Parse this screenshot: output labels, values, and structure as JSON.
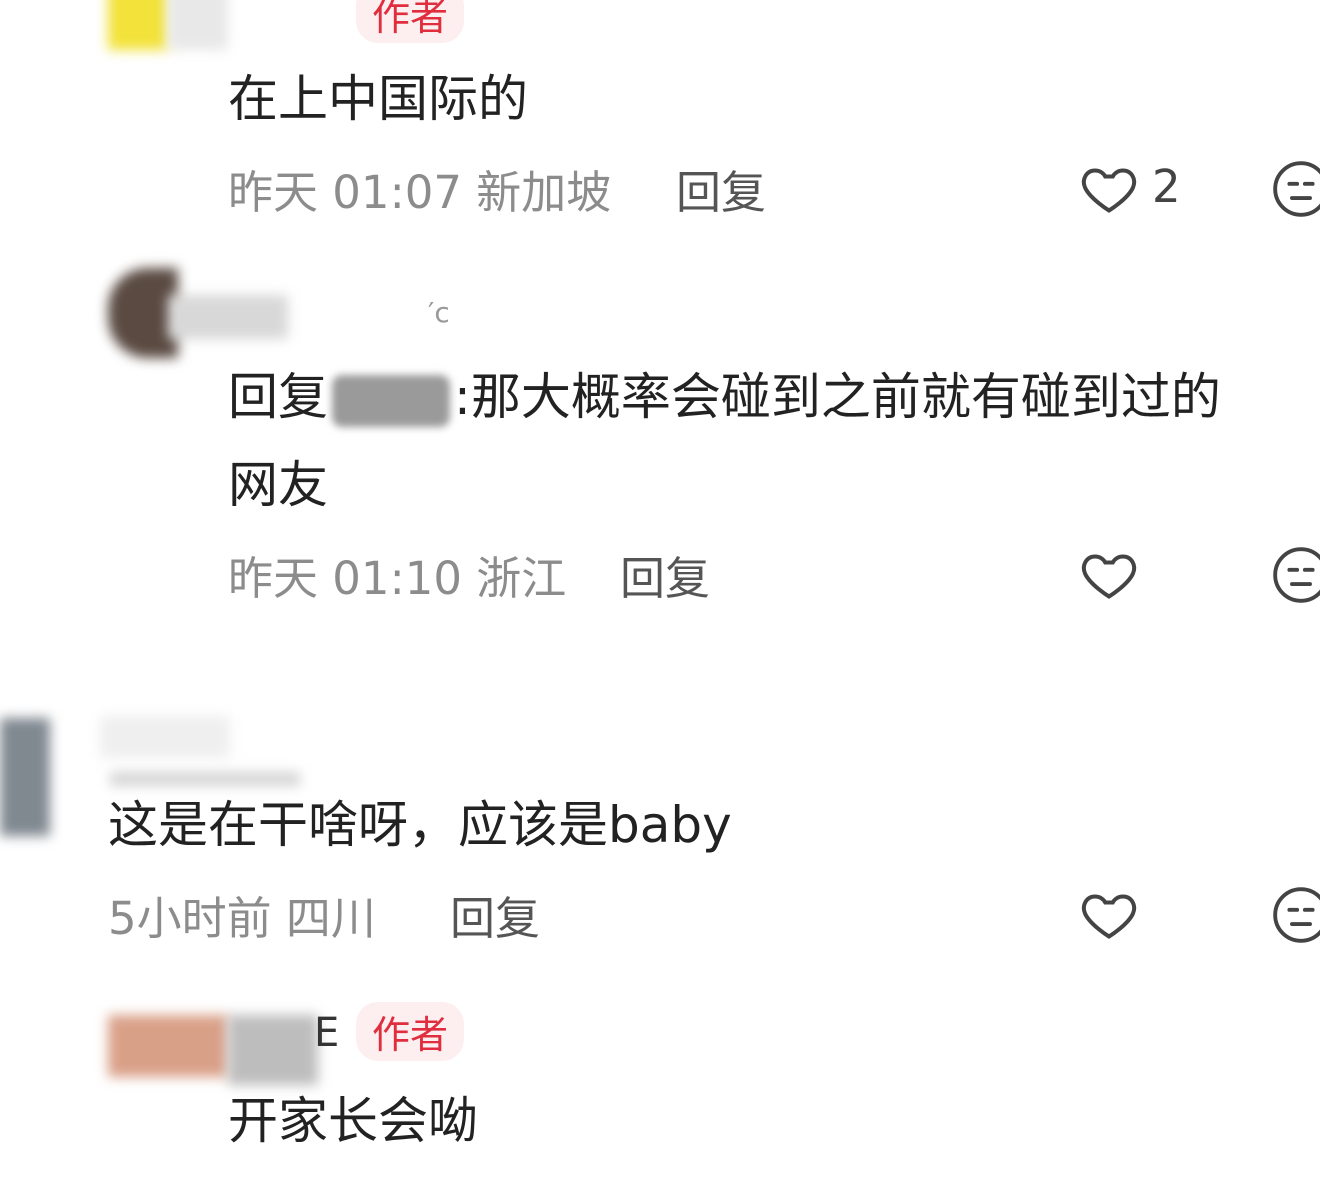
{
  "comments": [
    {
      "author_tag": "作者",
      "body": "在上中国际的",
      "meta": "昨天 01:07 新加坡",
      "reply_label": "回复",
      "like_count": "2"
    },
    {
      "username_partial": "′с",
      "reply_prefix": "回复",
      "mention_suffix": ":",
      "body_line1": "那大概率会碰到之前就有碰到过的",
      "body_line2": "网友",
      "meta": "昨天 01:10 浙江",
      "reply_label": "回复"
    },
    {
      "body": "这是在干啥呀，应该是baby",
      "meta": "5小时前 四川",
      "reply_label": "回复"
    },
    {
      "author_tag": "作者",
      "username_partial": "E",
      "body": "开家长会呦"
    }
  ],
  "icons": {
    "like": "heart-outline-icon",
    "dislike": "meh-face-icon"
  },
  "colors": {
    "author_tag_bg": "#fdeef0",
    "author_tag_text": "#e02e3e",
    "meta_text": "#8c8c8c"
  }
}
